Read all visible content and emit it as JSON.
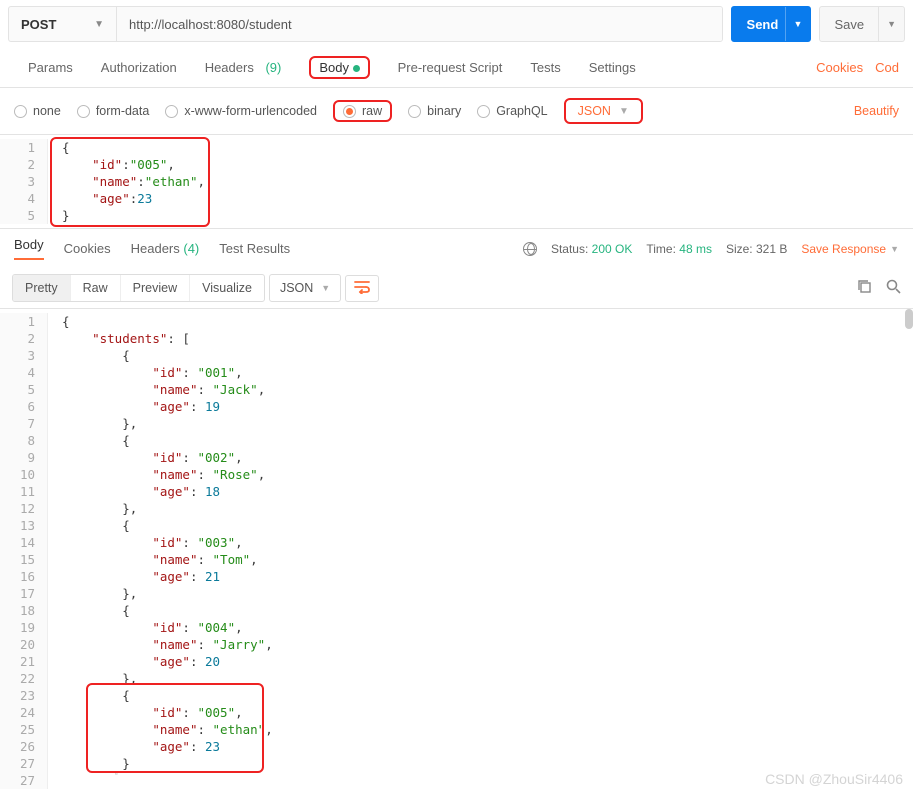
{
  "request": {
    "method": "POST",
    "url": "http://localhost:8080/student",
    "send_label": "Send",
    "save_label": "Save"
  },
  "req_tabs": {
    "params": "Params",
    "authorization": "Authorization",
    "headers": "Headers",
    "headers_count": "(9)",
    "body": "Body",
    "prerequest": "Pre-request Script",
    "tests": "Tests",
    "settings": "Settings",
    "cookies": "Cookies",
    "code": "Cod"
  },
  "body_types": {
    "none": "none",
    "formdata": "form-data",
    "xform": "x-www-form-urlencoded",
    "raw": "raw",
    "binary": "binary",
    "graphql": "GraphQL",
    "json_label": "JSON",
    "beautify": "Beautify"
  },
  "request_body_lines": [
    "{",
    "    \"id\":\"005\",",
    "    \"name\":\"ethan\",",
    "    \"age\":23",
    "}"
  ],
  "resp_tabs": {
    "body": "Body",
    "cookies": "Cookies",
    "headers": "Headers",
    "headers_count": "(4)",
    "testresults": "Test Results"
  },
  "status": {
    "status_label": "Status:",
    "status_value": "200 OK",
    "time_label": "Time:",
    "time_value": "48 ms",
    "size_label": "Size:",
    "size_value": "321 B",
    "save_response": "Save Response"
  },
  "view_toolbar": {
    "pretty": "Pretty",
    "raw": "Raw",
    "preview": "Preview",
    "visualize": "Visualize",
    "json": "JSON"
  },
  "response_body_lines": [
    "{",
    "    \"students\": [",
    "        {",
    "            \"id\": \"001\",",
    "            \"name\": \"Jack\",",
    "            \"age\": 19",
    "        },",
    "        {",
    "            \"id\": \"002\",",
    "            \"name\": \"Rose\",",
    "            \"age\": 18",
    "        },",
    "        {",
    "            \"id\": \"003\",",
    "            \"name\": \"Tom\",",
    "            \"age\": 21",
    "        },",
    "        {",
    "            \"id\": \"004\",",
    "            \"name\": \"Jarry\",",
    "            \"age\": 20",
    "        },",
    "        {",
    "            \"id\": \"005\",",
    "            \"name\": \"ethan\",",
    "            \"age\": 23",
    "        }"
  ],
  "watermark": "CSDN @ZhouSir4406"
}
